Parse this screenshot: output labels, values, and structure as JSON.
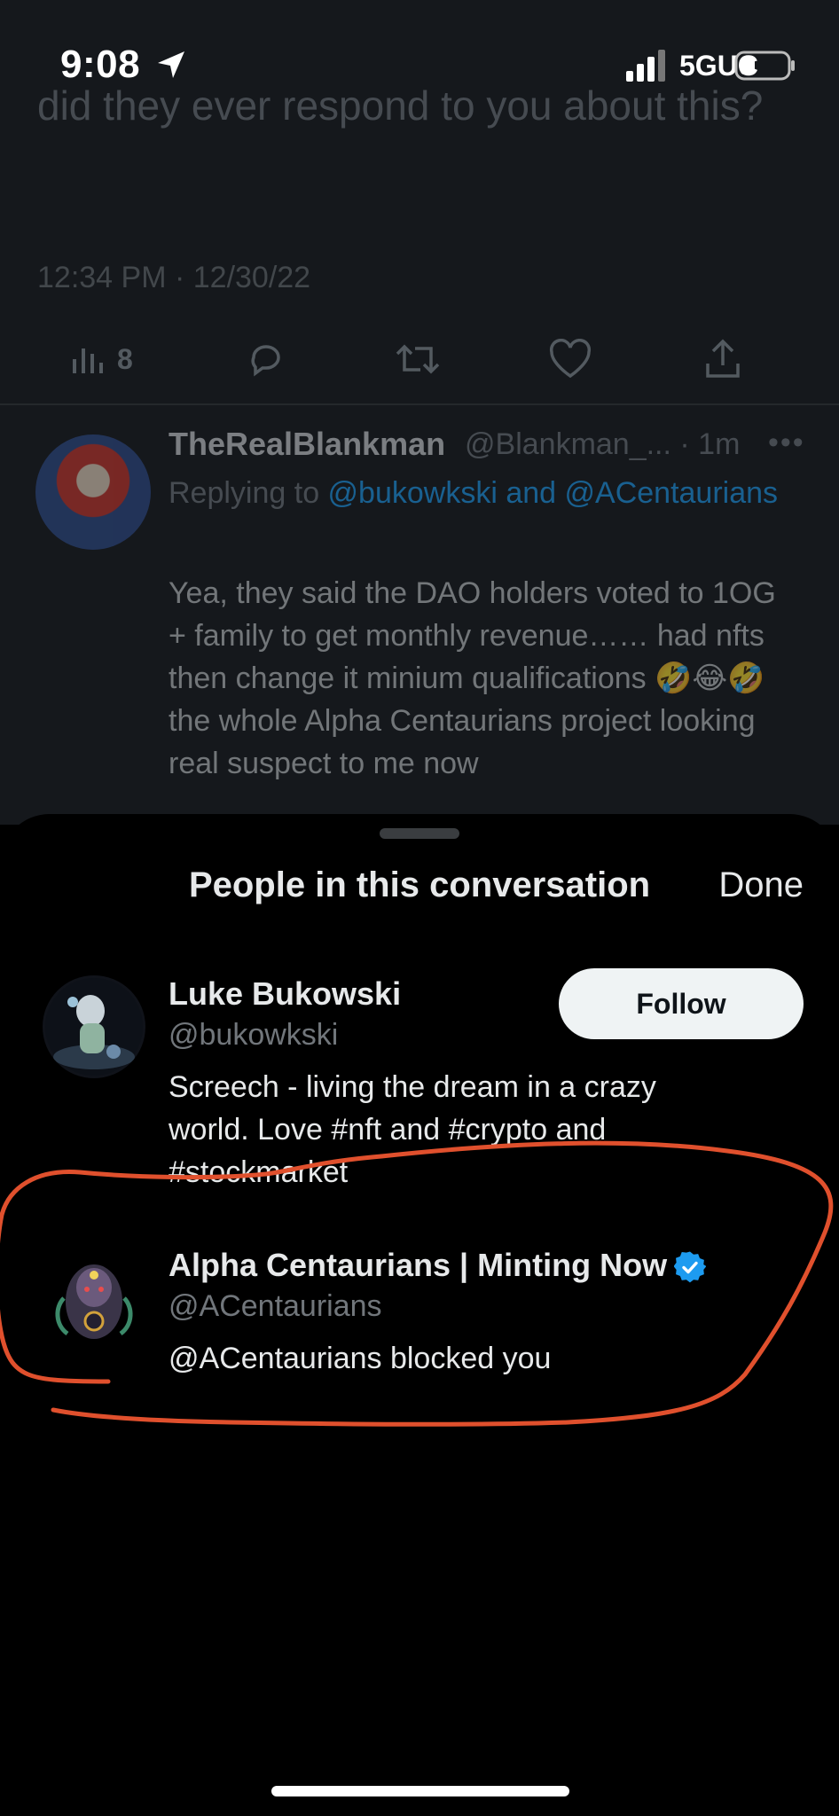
{
  "status_bar": {
    "time": "9:08",
    "network": "5GUC"
  },
  "background_tweet": {
    "text": "did they ever respond to you about this?",
    "timestamp": "12:34 PM · 12/30/22",
    "views_count": "8"
  },
  "reply": {
    "name": "TheRealBlankman",
    "handle": "@Blankman_...",
    "age": "· 1m",
    "replying_prefix": "Replying to ",
    "replying_to": "@bukowkski and @ACentaurians",
    "body": "Yea, they said the DAO holders voted to 1OG + family to get monthly revenue…… had nfts then change it minium qualifications 🤣😂🤣 the whole Alpha Centaurians project looking real suspect to me now"
  },
  "sheet": {
    "title": "People in this conversation",
    "done_label": "Done",
    "people": [
      {
        "name": "Luke Bukowski",
        "handle": "@bukowkski",
        "bio": "Screech - living the dream in a crazy world. Love #nft and #crypto and #stockmarket",
        "follow_label": "Follow"
      },
      {
        "name": "Alpha Centaurians | Minting Now",
        "handle": "@ACentaurians",
        "bio": "@ACentaurians blocked you",
        "verified": true
      }
    ]
  },
  "colors": {
    "accent": "#1d9bf0",
    "annotation": "#e0502d",
    "sheet_bg": "#000000"
  }
}
